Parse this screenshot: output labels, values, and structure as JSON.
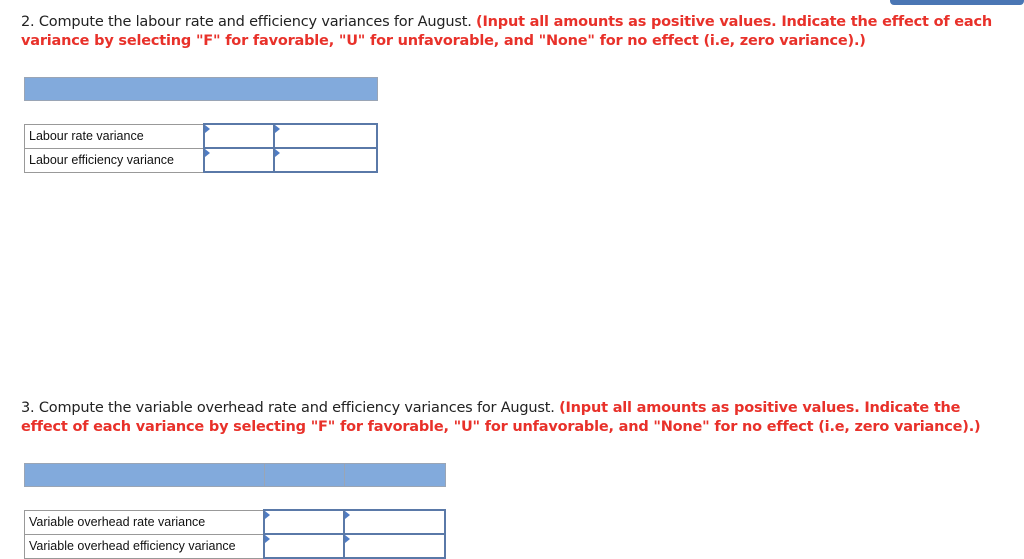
{
  "question2": {
    "text": "2. Compute the labour rate and efficiency variances for August. ",
    "instruction": "(Input all amounts as positive values. Indicate the effect of each variance by selecting \"F\" for favorable, \"U\" for unfavorable, and \"None\" for no effect (i.e, zero variance).)",
    "rows": [
      {
        "label": "Labour rate variance",
        "amount": "",
        "effect": ""
      },
      {
        "label": "Labour efficiency variance",
        "amount": "",
        "effect": ""
      }
    ]
  },
  "question3": {
    "text": "3. Compute the variable overhead rate and efficiency variances for August. ",
    "instruction": "(Input all amounts as positive values. Indicate the effect of each variance by selecting \"F\" for favorable, \"U\" for unfavorable, and \"None\" for no effect (i.e, zero variance).)",
    "rows": [
      {
        "label": "Variable overhead rate variance",
        "amount": "",
        "effect": ""
      },
      {
        "label": "Variable overhead efficiency variance",
        "amount": "",
        "effect": ""
      }
    ]
  },
  "colors": {
    "header_fill": "#82aadc",
    "instruction": "#e8312a",
    "input_border": "#5a79a8"
  }
}
